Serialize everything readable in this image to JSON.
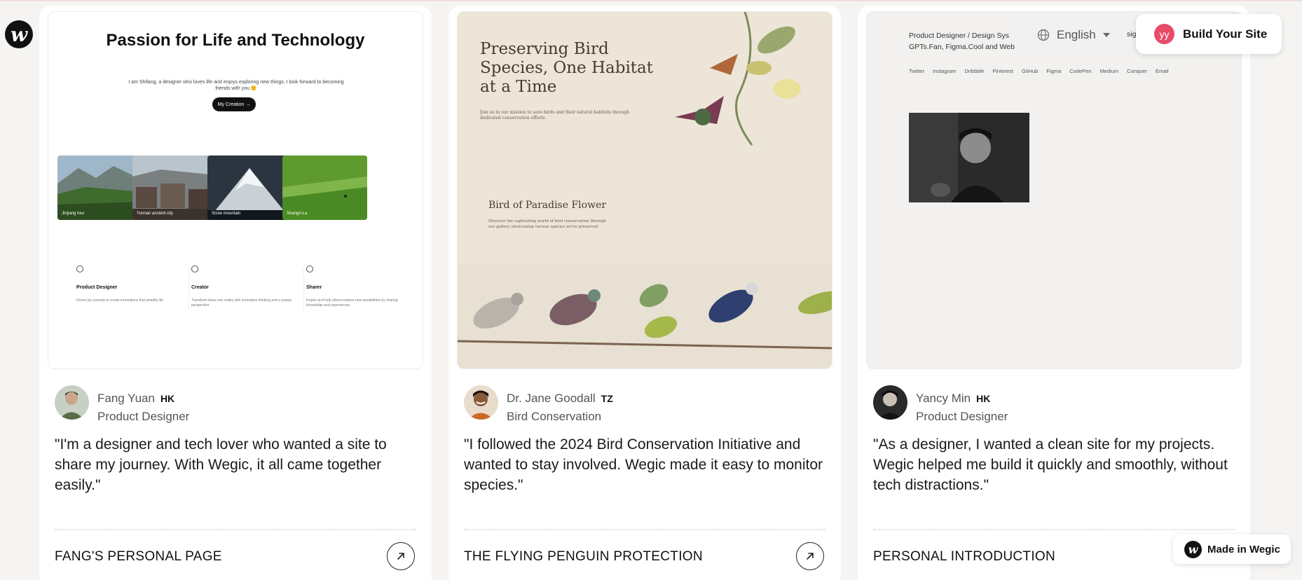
{
  "brand": {
    "logo_glyph": "w"
  },
  "header": {
    "language": "English",
    "build_avatar": "yy",
    "build_label": "Build Your Site"
  },
  "made_badge": {
    "glyph": "w",
    "label": "Made in Wegic"
  },
  "cards": [
    {
      "preview": {
        "title": "Passion for Life and Technology",
        "subtitle": "I am Shifang, a designer who loves life and enjoys exploring new things. I look forward to becoming friends with you 🙂",
        "cta": "My Creation →",
        "thumbs": [
          "Jinjiang tour",
          "Yunnan ancient city",
          "Snow mountain",
          "Shangri-La"
        ],
        "features": [
          {
            "title": "Product Designer",
            "desc": "Driven by curiosity to create innovations that simplify life"
          },
          {
            "title": "Creator",
            "desc": "Transform ideas into reality with innovative thinking and a unique perspective"
          },
          {
            "title": "Sharer",
            "desc": "Inspire and help others explore new possibilities by sharing knowledge and experiences."
          }
        ]
      },
      "name": "Fang Yuan",
      "country": "HK",
      "role": "Product Designer",
      "quote": "\"I'm a designer and tech lover who wanted a site to share my journey. With Wegic, it all came together easily.\"",
      "site_title": "FANG'S PERSONAL PAGE"
    },
    {
      "preview": {
        "title": "Preserving Bird Species, One Habitat at a Time",
        "subtitle": "Join us in our mission to save birds and their natural habitats through dedicated conservation efforts.",
        "section_title": "Bird of Paradise Flower",
        "section_desc": "Discover the captivating world of bird conservation through our gallery showcasing various species we've preserved"
      },
      "name": "Dr. Jane Goodall",
      "country": "TZ",
      "role": "Bird Conservation",
      "quote": "\"I followed the 2024 Bird Conservation Initiative and wanted to stay involved. Wegic made it easy to monitor species.\"",
      "site_title": "THE FLYING PENGUIN PROTECTION"
    },
    {
      "preview": {
        "title_line1": "Product Designer / Design Sys",
        "title_line2": "GPTs.Fan, Figma.Cool and Web",
        "title_clip": "sig",
        "links": [
          "Twitter",
          "Instagram",
          "Dribbble",
          "Pinterest",
          "GitHub",
          "Figma",
          "CodePen",
          "Medium",
          "Conquer",
          "Email"
        ]
      },
      "name": "Yancy Min",
      "country": "HK",
      "role": "Product Designer",
      "quote": "\"As a designer, I wanted a clean site for my projects. Wegic helped me build it quickly and smoothly, without tech distractions.\"",
      "site_title": "PERSONAL INTRODUCTION"
    }
  ]
}
